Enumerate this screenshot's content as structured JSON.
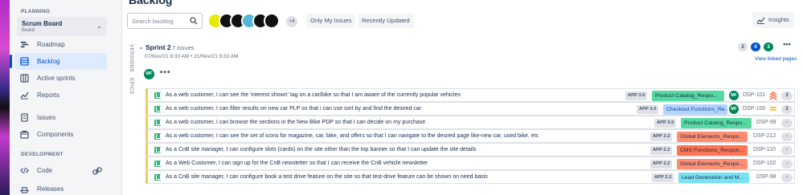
{
  "colors": {
    "accent": "#0052cc",
    "story_green": "#36b37e",
    "avatar_green": "#00875a"
  },
  "sidebar": {
    "planning_label": "PLANNING",
    "board": {
      "name": "Scrum Board",
      "subtitle": "Board"
    },
    "items": [
      {
        "label": "Roadmap",
        "icon": "roadmap-icon"
      },
      {
        "label": "Backlog",
        "icon": "backlog-icon",
        "active": true
      },
      {
        "label": "Active sprints",
        "icon": "board-columns-icon"
      },
      {
        "label": "Reports",
        "icon": "chart-line-icon"
      },
      {
        "label": "Issues",
        "icon": "issues-icon"
      },
      {
        "label": "Components",
        "icon": "components-icon"
      }
    ],
    "development_label": "DEVELOPMENT",
    "dev_items": [
      {
        "label": "Code",
        "icon": "code-icon"
      },
      {
        "label": "Releases",
        "icon": "ship-icon"
      }
    ]
  },
  "header": {
    "title": "Backlog",
    "search_placeholder": "Search backlog",
    "avatar_more": "+4",
    "filters": [
      "Only My Issues",
      "Recently Updated"
    ],
    "insights_label": "Insights"
  },
  "side_labels": {
    "versions": "VERSIONS",
    "epics": "EPICS"
  },
  "sprint": {
    "name": "Sprint 2",
    "issue_count": "7 issues",
    "dates": "07/Nov/21 8:33 AM • 21/Nov/21 9:33 AM",
    "counts": [
      "2",
      "0",
      "3"
    ],
    "linked_pages": "View linked pages",
    "assignee_initials": "MF"
  },
  "issues": [
    {
      "summary": "As a web customer, I can see the 'interest shown' tag on a car/bike so that I am aware of the currently popular vehicles",
      "version": "APP 3.0",
      "epic": "Product Catalog_Respo...",
      "epic_color": "#57d9a3",
      "assignee": "MF",
      "key": "DSP-101",
      "priority": "highest",
      "estimate": "3"
    },
    {
      "summary": "As a web customer, I can filter results on new car PLP so that i can use sort by and find the desired car",
      "version": "APP 3.0",
      "epic": "Checkout Functions_Re...",
      "epic_color": "#b3d4ff",
      "assignee": "MF",
      "key": "DSP-100",
      "priority": "",
      "estimate": "2"
    },
    {
      "summary": "As a web customer, I can browse the sections in the New Bike PDP so that I can decide on my purchase",
      "version": "APP 3.0",
      "epic": "Product Catalog_Respo...",
      "epic_color": "#57d9a3",
      "assignee": "",
      "key": "DSP-99",
      "priority": "",
      "estimate": "-"
    },
    {
      "summary": "As a web customer, I can see the set of icons for magazine, car, bike, and offers so that I can navigate to the desired page like-new car, used bike, etc",
      "version": "APP 2.2",
      "epic": "Global Elements_Respo...",
      "epic_color": "#ff8f73",
      "assignee": "",
      "key": "DSP-212",
      "priority": "",
      "estimate": "-"
    },
    {
      "summary": "As a CnB site manager, I can configure slots (cards) on the site other than the top banner so that I can update the site details",
      "version": "APP 2.2",
      "epic": "CMS Functions_Respon...",
      "epic_color": "#ff7452",
      "assignee": "",
      "key": "DSP-110",
      "priority": "",
      "estimate": "-"
    },
    {
      "summary": "As a Web Customer, I can sign up for the CnB newsletter so that I can receive the CnB vehicle newsletter",
      "version": "APP 2.2",
      "epic": "Global Elements_Respo...",
      "epic_color": "#ff8f73",
      "assignee": "",
      "key": "DSP-102",
      "priority": "",
      "estimate": "-"
    },
    {
      "summary": "As a CnB site manager, I can configure book a test drive feature on the site so that test-drive feature can be shown on need basis",
      "version": "APP 2.2",
      "epic": "Lead Generation and M...",
      "epic_color": "#79e2f2",
      "assignee": "",
      "key": "DSP-98",
      "priority": "",
      "estimate": "-"
    }
  ]
}
